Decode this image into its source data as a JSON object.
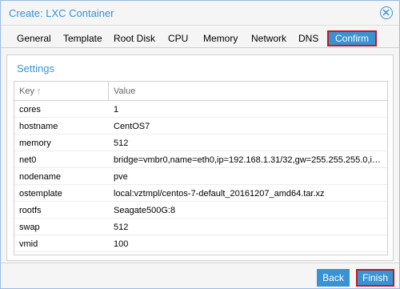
{
  "window": {
    "title": "Create: LXC Container",
    "close_icon": "close-circle-icon",
    "accent_color": "#3892d4",
    "highlight_color": "#c6171d"
  },
  "tabs": [
    {
      "label": "General",
      "active": false
    },
    {
      "label": "Template",
      "active": false
    },
    {
      "label": "Root Disk",
      "active": false
    },
    {
      "label": "CPU",
      "active": false
    },
    {
      "label": "Memory",
      "active": false
    },
    {
      "label": "Network",
      "active": false
    },
    {
      "label": "DNS",
      "active": false
    },
    {
      "label": "Confirm",
      "active": true
    }
  ],
  "settings": {
    "title": "Settings",
    "columns": {
      "key": "Key",
      "key_sort_icon": "sort-asc-icon",
      "value": "Value"
    },
    "rows": [
      {
        "key": "cores",
        "value": "1"
      },
      {
        "key": "hostname",
        "value": "CentOS7"
      },
      {
        "key": "memory",
        "value": "512"
      },
      {
        "key": "net0",
        "value": "bridge=vmbr0,name=eth0,ip=192.168.1.31/32,gw=255.255.255.0,ip6=d..."
      },
      {
        "key": "nodename",
        "value": "pve"
      },
      {
        "key": "ostemplate",
        "value": "local:vztmpl/centos-7-default_20161207_amd64.tar.xz"
      },
      {
        "key": "rootfs",
        "value": "Seagate500G:8"
      },
      {
        "key": "swap",
        "value": "512"
      },
      {
        "key": "vmid",
        "value": "100"
      }
    ]
  },
  "footer": {
    "back_label": "Back",
    "finish_label": "Finish"
  }
}
